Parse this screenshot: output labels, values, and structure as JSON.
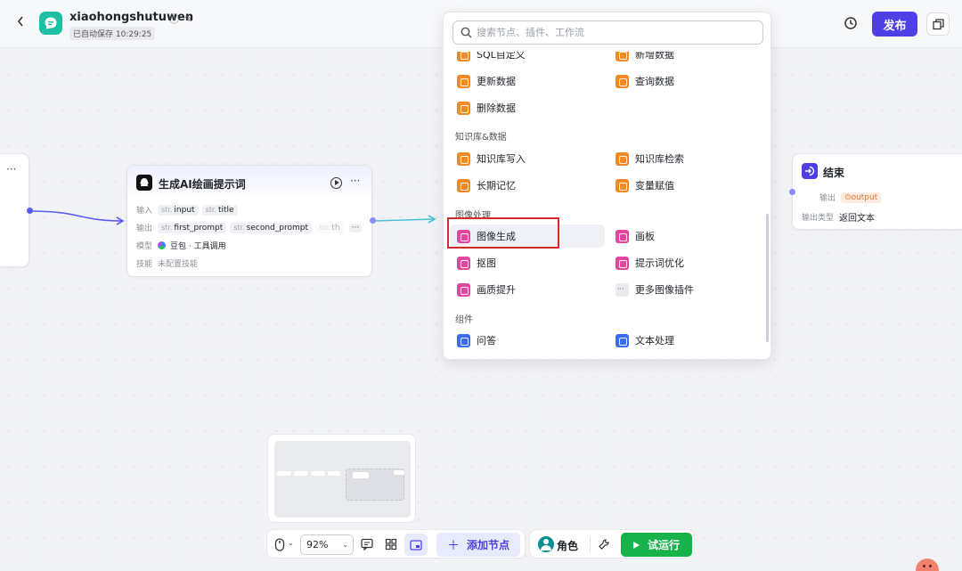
{
  "header": {
    "back_icon": "chevron-left-icon",
    "app_title": "xiaohongshutuwen",
    "autosave": "已自动保存 10:29:25",
    "publish_label": "发布",
    "brand_color": "#4e40e5"
  },
  "node_mid": {
    "title": "生成AI绘画提示词",
    "input_label": "输入",
    "inputs": [
      {
        "type": "str.",
        "name": "input"
      },
      {
        "type": "str.",
        "name": "title"
      }
    ],
    "output_label": "输出",
    "outputs": [
      {
        "type": "str.",
        "name": "first_prompt"
      },
      {
        "type": "str.",
        "name": "second_prompt"
      },
      {
        "type": "str.",
        "name": "th"
      }
    ],
    "more": "···",
    "model_label": "模型",
    "model_value": "豆包 · 工具调用",
    "skill_label": "技能",
    "skill_value": "未配置技能"
  },
  "node_end": {
    "title": "结束",
    "output_label": "输出",
    "output_tag": "output",
    "output_type_label": "输出类型",
    "output_type_value": "返回文本"
  },
  "popup": {
    "search_placeholder": "搜索节点、插件、工作流",
    "partial_items": [
      "SQL自定义",
      "新增数据"
    ],
    "rows_top": [
      {
        "left": "更新数据",
        "right": "查询数据"
      },
      {
        "left": "删除数据",
        "right": ""
      }
    ],
    "section_kb": "知识库&数据",
    "rows_kb": [
      {
        "left": "知识库写入",
        "right": "知识库检索"
      },
      {
        "left": "长期记忆",
        "right": "变量赋值"
      }
    ],
    "section_image": "图像处理",
    "rows_image": [
      {
        "left": "图像生成",
        "right": "画板"
      },
      {
        "left": "抠图",
        "right": "提示词优化"
      },
      {
        "left": "画质提升",
        "right": "更多图像插件"
      }
    ],
    "section_comp": "组件",
    "rows_comp": [
      {
        "left": "问答",
        "right": "文本处理"
      }
    ]
  },
  "toolbar": {
    "zoom": "92%",
    "add_node_label": "添加节点",
    "role_label": "角色",
    "run_label": "试运行",
    "run_color": "#17b24a"
  }
}
